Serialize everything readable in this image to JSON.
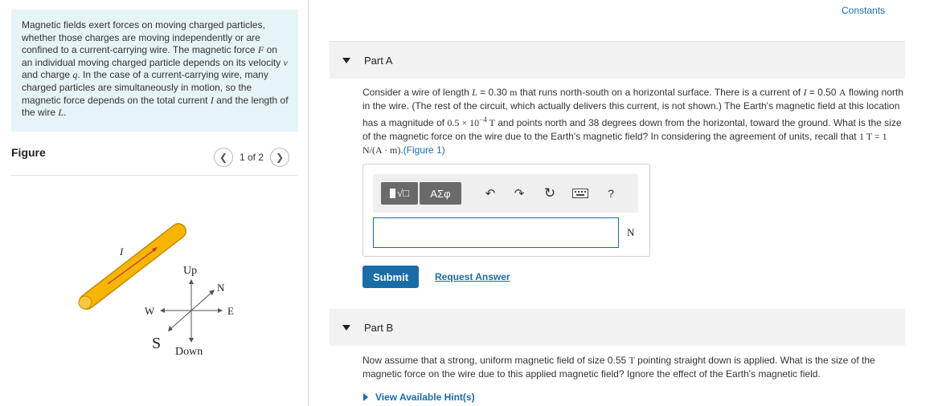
{
  "intro": {
    "p1": "Magnetic fields exert forces on moving charged particles, whether those charges are moving independently or are confined to a current-carrying wire. The magnetic force ",
    "F": "F",
    "p2": " on an individual moving charged particle depends on its velocity ",
    "v": "v",
    "p3": " and charge ",
    "q": "q",
    "p4": ". In the case of a current-carrying wire, many charged particles are simultaneously in motion, so the magnetic force depends on the total current ",
    "I": "I",
    "p5": " and the length of the wire ",
    "L": "L",
    "p6": "."
  },
  "figure": {
    "title": "Figure",
    "pager": "1 of 2",
    "prev_icon": "chevron-left-icon",
    "next_icon": "chevron-right-icon",
    "labels": {
      "current": "I",
      "up": "Up",
      "north": "N",
      "west": "W",
      "east": "E",
      "south": "S",
      "down": "Down"
    },
    "wire_color": "#f7b500",
    "arrow_color": "#c0305a"
  },
  "constants": "Constants",
  "partA": {
    "label": "Part A",
    "q_1": "Consider a wire of length ",
    "q_L": "L",
    "q_2": " = 0.30 ",
    "q_m": "m",
    "q_3": " that runs north-south on a horizontal surface. There is a current of ",
    "q_I": "I",
    "q_4": " = 0.50 ",
    "q_A": "A",
    "q_5": " flowing north in the wire. (The rest of the circuit, which actually delivers this current, is not shown.) The Earth's magnetic field at this location has a magnitude of ",
    "q_B": "0.5 × 10",
    "q_exp": "−4",
    "q_T": " T",
    "q_6": " and points north and 38 degrees down from the horizontal, toward the ground. What is the size of the magnetic force on the wire due to the Earth's magnetic field? In considering the  agreement of units, recall that ",
    "q_rel": "1 T = 1 N/(A · m)",
    "q_7": ".",
    "q_fig": "(Figure 1)",
    "toolbar": {
      "templates_icon": "templates-icon",
      "greek": "ΑΣφ",
      "undo_icon": "undo-icon",
      "redo_icon": "redo-icon",
      "reset_icon": "reset-icon",
      "keyboard_icon": "keyboard-icon",
      "help": "?"
    },
    "answer_value": "",
    "unit": "N",
    "submit": "Submit",
    "request": "Request Answer"
  },
  "partB": {
    "label": "Part B",
    "q_1": "Now assume that a strong, uniform magnetic field of size 0.55 ",
    "q_T": "T",
    "q_2": " pointing straight down is applied. What is the size of the magnetic force on the wire due to this applied magnetic field? Ignore the effect of the Earth's magnetic field.",
    "hint": "View Available Hint(s)"
  }
}
